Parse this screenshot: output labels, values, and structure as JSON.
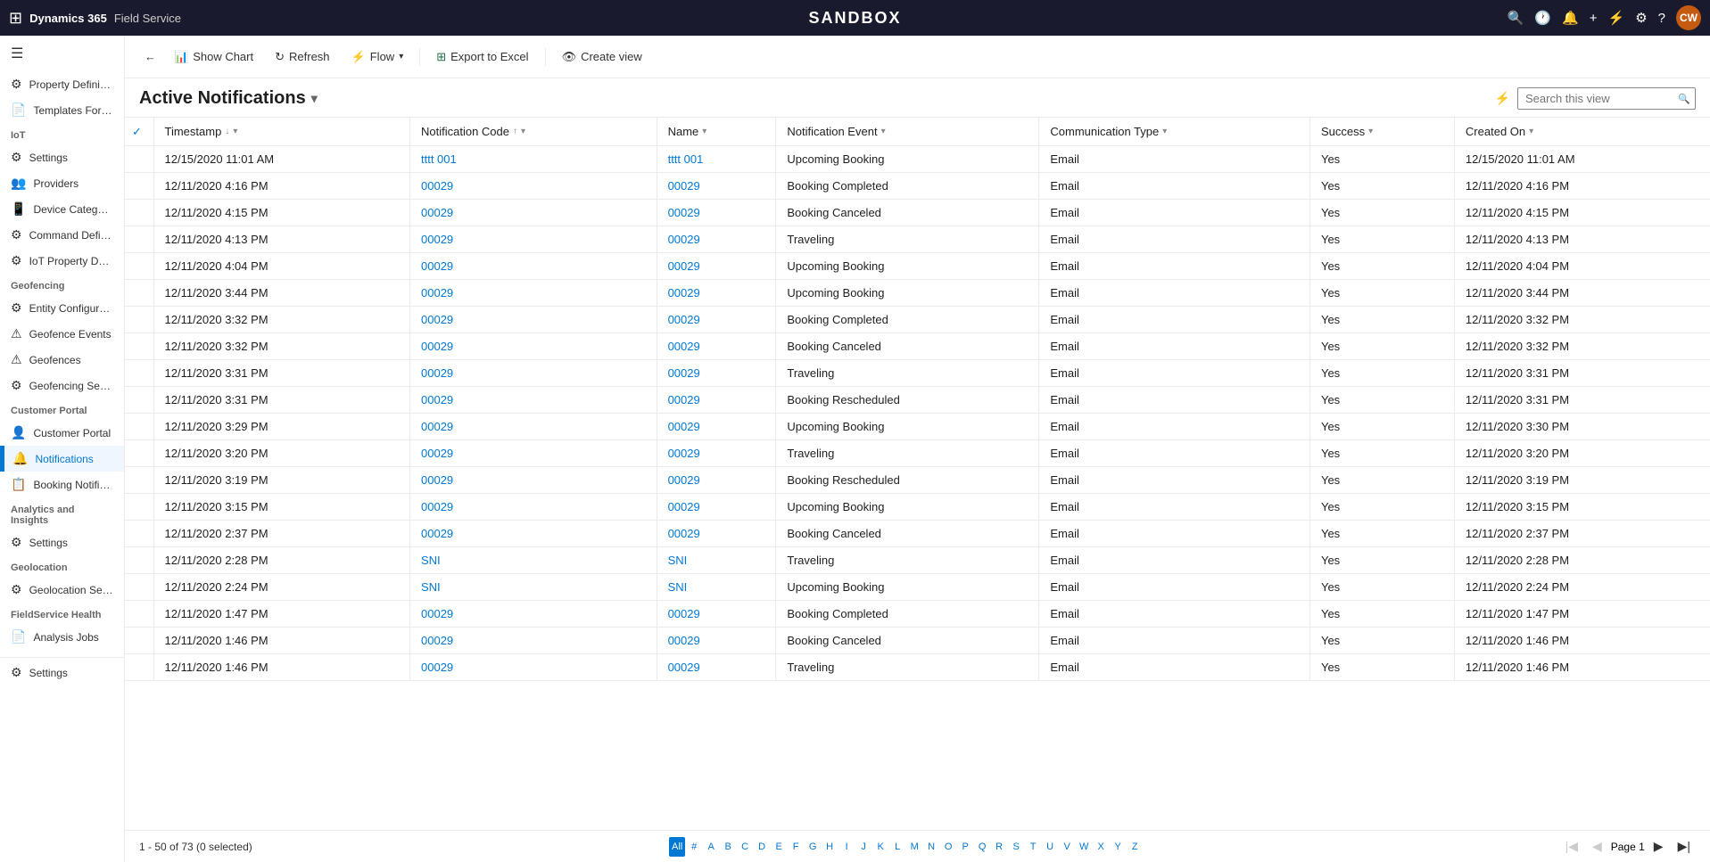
{
  "app": {
    "title": "SANDBOX",
    "product": "Dynamics 365",
    "module": "Field Service"
  },
  "toolbar": {
    "show_chart": "Show Chart",
    "refresh": "Refresh",
    "flow": "Flow",
    "export_to_excel": "Export to Excel",
    "create_view": "Create view"
  },
  "view": {
    "title": "Active Notifications",
    "search_placeholder": "Search this view"
  },
  "columns": [
    {
      "key": "timestamp",
      "label": "Timestamp",
      "sort": "desc"
    },
    {
      "key": "notification_code",
      "label": "Notification Code",
      "sort": "asc"
    },
    {
      "key": "name",
      "label": "Name",
      "sort": "none"
    },
    {
      "key": "notification_event",
      "label": "Notification Event",
      "sort": "none"
    },
    {
      "key": "communication_type",
      "label": "Communication Type",
      "sort": "none"
    },
    {
      "key": "success",
      "label": "Success",
      "sort": "none"
    },
    {
      "key": "created_on",
      "label": "Created On",
      "sort": "none"
    }
  ],
  "rows": [
    {
      "timestamp": "12/15/2020 11:01 AM",
      "code": "tttt 001",
      "name": "tttt 001",
      "event": "Upcoming Booking",
      "comm_type": "Email",
      "success": "Yes",
      "created_on": "12/15/2020 11:01 AM"
    },
    {
      "timestamp": "12/11/2020 4:16 PM",
      "code": "00029",
      "name": "00029",
      "event": "Booking Completed",
      "comm_type": "Email",
      "success": "Yes",
      "created_on": "12/11/2020 4:16 PM"
    },
    {
      "timestamp": "12/11/2020 4:15 PM",
      "code": "00029",
      "name": "00029",
      "event": "Booking Canceled",
      "comm_type": "Email",
      "success": "Yes",
      "created_on": "12/11/2020 4:15 PM"
    },
    {
      "timestamp": "12/11/2020 4:13 PM",
      "code": "00029",
      "name": "00029",
      "event": "Traveling",
      "comm_type": "Email",
      "success": "Yes",
      "created_on": "12/11/2020 4:13 PM"
    },
    {
      "timestamp": "12/11/2020 4:04 PM",
      "code": "00029",
      "name": "00029",
      "event": "Upcoming Booking",
      "comm_type": "Email",
      "success": "Yes",
      "created_on": "12/11/2020 4:04 PM"
    },
    {
      "timestamp": "12/11/2020 3:44 PM",
      "code": "00029",
      "name": "00029",
      "event": "Upcoming Booking",
      "comm_type": "Email",
      "success": "Yes",
      "created_on": "12/11/2020 3:44 PM"
    },
    {
      "timestamp": "12/11/2020 3:32 PM",
      "code": "00029",
      "name": "00029",
      "event": "Booking Completed",
      "comm_type": "Email",
      "success": "Yes",
      "created_on": "12/11/2020 3:32 PM"
    },
    {
      "timestamp": "12/11/2020 3:32 PM",
      "code": "00029",
      "name": "00029",
      "event": "Booking Canceled",
      "comm_type": "Email",
      "success": "Yes",
      "created_on": "12/11/2020 3:32 PM"
    },
    {
      "timestamp": "12/11/2020 3:31 PM",
      "code": "00029",
      "name": "00029",
      "event": "Traveling",
      "comm_type": "Email",
      "success": "Yes",
      "created_on": "12/11/2020 3:31 PM"
    },
    {
      "timestamp": "12/11/2020 3:31 PM",
      "code": "00029",
      "name": "00029",
      "event": "Booking Rescheduled",
      "comm_type": "Email",
      "success": "Yes",
      "created_on": "12/11/2020 3:31 PM"
    },
    {
      "timestamp": "12/11/2020 3:29 PM",
      "code": "00029",
      "name": "00029",
      "event": "Upcoming Booking",
      "comm_type": "Email",
      "success": "Yes",
      "created_on": "12/11/2020 3:30 PM"
    },
    {
      "timestamp": "12/11/2020 3:20 PM",
      "code": "00029",
      "name": "00029",
      "event": "Traveling",
      "comm_type": "Email",
      "success": "Yes",
      "created_on": "12/11/2020 3:20 PM"
    },
    {
      "timestamp": "12/11/2020 3:19 PM",
      "code": "00029",
      "name": "00029",
      "event": "Booking Rescheduled",
      "comm_type": "Email",
      "success": "Yes",
      "created_on": "12/11/2020 3:19 PM"
    },
    {
      "timestamp": "12/11/2020 3:15 PM",
      "code": "00029",
      "name": "00029",
      "event": "Upcoming Booking",
      "comm_type": "Email",
      "success": "Yes",
      "created_on": "12/11/2020 3:15 PM"
    },
    {
      "timestamp": "12/11/2020 2:37 PM",
      "code": "00029",
      "name": "00029",
      "event": "Booking Canceled",
      "comm_type": "Email",
      "success": "Yes",
      "created_on": "12/11/2020 2:37 PM"
    },
    {
      "timestamp": "12/11/2020 2:28 PM",
      "code": "SNI",
      "name": "SNI",
      "event": "Traveling",
      "comm_type": "Email",
      "success": "Yes",
      "created_on": "12/11/2020 2:28 PM"
    },
    {
      "timestamp": "12/11/2020 2:24 PM",
      "code": "SNI",
      "name": "SNI",
      "event": "Upcoming Booking",
      "comm_type": "Email",
      "success": "Yes",
      "created_on": "12/11/2020 2:24 PM"
    },
    {
      "timestamp": "12/11/2020 1:47 PM",
      "code": "00029",
      "name": "00029",
      "event": "Booking Completed",
      "comm_type": "Email",
      "success": "Yes",
      "created_on": "12/11/2020 1:47 PM"
    },
    {
      "timestamp": "12/11/2020 1:46 PM",
      "code": "00029",
      "name": "00029",
      "event": "Booking Canceled",
      "comm_type": "Email",
      "success": "Yes",
      "created_on": "12/11/2020 1:46 PM"
    },
    {
      "timestamp": "12/11/2020 1:46 PM",
      "code": "00029",
      "name": "00029",
      "event": "Traveling",
      "comm_type": "Email",
      "success": "Yes",
      "created_on": "12/11/2020 1:46 PM"
    }
  ],
  "pagination": {
    "info": "1 - 50 of 73 (0 selected)",
    "current_page": "Page 1",
    "alpha_active": "All"
  },
  "alpha_letters": [
    "All",
    "#",
    "A",
    "B",
    "C",
    "D",
    "E",
    "F",
    "G",
    "H",
    "I",
    "J",
    "K",
    "L",
    "M",
    "N",
    "O",
    "P",
    "Q",
    "R",
    "S",
    "T",
    "U",
    "V",
    "W",
    "X",
    "Y",
    "Z"
  ],
  "sidebar": {
    "sections": [
      {
        "label": "",
        "items": [
          {
            "id": "property-def",
            "icon": "⚙",
            "label": "Property Definiti..."
          },
          {
            "id": "templates-pro",
            "icon": "📄",
            "label": "Templates For Pro..."
          }
        ]
      },
      {
        "label": "IoT",
        "items": [
          {
            "id": "settings",
            "icon": "⚙",
            "label": "Settings"
          },
          {
            "id": "providers",
            "icon": "👥",
            "label": "Providers"
          },
          {
            "id": "device-categories",
            "icon": "📱",
            "label": "Device Categories"
          },
          {
            "id": "command-definit",
            "icon": "⚙",
            "label": "Command Definiti..."
          },
          {
            "id": "iot-property-def",
            "icon": "⚙",
            "label": "IoT Property Defi..."
          }
        ]
      },
      {
        "label": "Geofencing",
        "items": [
          {
            "id": "entity-config",
            "icon": "⚙",
            "label": "Entity Configura..."
          },
          {
            "id": "geofence-events",
            "icon": "⚠",
            "label": "Geofence Events"
          },
          {
            "id": "geofences",
            "icon": "⚠",
            "label": "Geofences"
          },
          {
            "id": "geofencing-sett",
            "icon": "⚙",
            "label": "Geofencing Settin..."
          }
        ]
      },
      {
        "label": "Customer Portal",
        "items": [
          {
            "id": "customer-portal",
            "icon": "👤",
            "label": "Customer Portal"
          },
          {
            "id": "notifications",
            "icon": "🔔",
            "label": "Notifications",
            "active": true
          },
          {
            "id": "booking-notif",
            "icon": "📋",
            "label": "Booking Notificati..."
          }
        ]
      },
      {
        "label": "Analytics and Insights",
        "items": [
          {
            "id": "settings-analytics",
            "icon": "⚙",
            "label": "Settings"
          }
        ]
      },
      {
        "label": "Geolocation",
        "items": [
          {
            "id": "geolocation-sett",
            "icon": "⚙",
            "label": "Geolocation Setti..."
          }
        ]
      },
      {
        "label": "FieldService Health",
        "items": [
          {
            "id": "analysis-jobs",
            "icon": "📄",
            "label": "Analysis Jobs"
          }
        ]
      }
    ]
  }
}
